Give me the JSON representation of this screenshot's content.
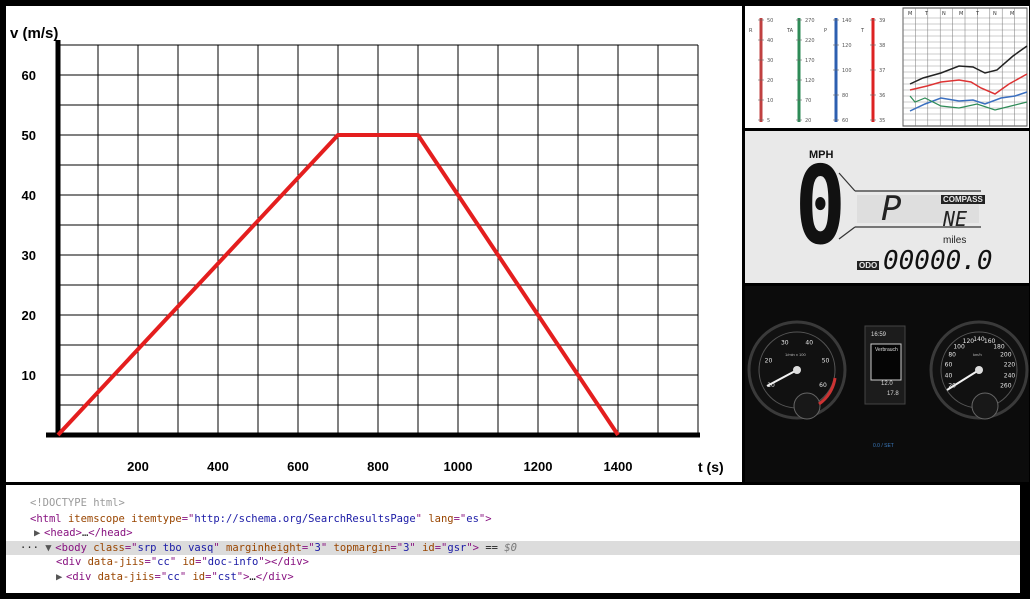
{
  "chart_data": {
    "type": "line",
    "xlabel": "t (s)",
    "ylabel": "v (m/s)",
    "x_ticks": [
      200,
      400,
      600,
      800,
      1000,
      1200,
      1400
    ],
    "y_ticks": [
      10,
      20,
      30,
      40,
      50,
      60
    ],
    "xlim": [
      0,
      1600
    ],
    "ylim": [
      0,
      65
    ],
    "grid": true,
    "x": [
      0,
      700,
      900,
      1400
    ],
    "series": [
      {
        "values": [
          0,
          50,
          50,
          0
        ],
        "color": "#e41e1e"
      }
    ]
  },
  "vitals_chart": {
    "scales": [
      {
        "label": "R",
        "ticks": [
          "50",
          "40",
          "30",
          "20",
          "10",
          "5"
        ],
        "color": "#c04040"
      },
      {
        "label": "TA",
        "ticks": [
          "270",
          "220",
          "170",
          "120",
          "70",
          "20"
        ],
        "color": "#2e8b57"
      },
      {
        "label": "P",
        "ticks": [
          "140",
          "120",
          "100",
          "80",
          "60"
        ],
        "color": "#2d5fb0"
      },
      {
        "label": "T",
        "ticks": [
          "39",
          "38",
          "37",
          "36",
          "35"
        ],
        "color": "#d22"
      }
    ],
    "day_header": [
      "M",
      "T",
      "N",
      "M",
      "T",
      "N",
      "M"
    ]
  },
  "lcd": {
    "unit": "MPH",
    "speed": "0",
    "gear": "P",
    "compass_label": "COMPASS",
    "compass_value": "NE",
    "miles_label": "miles",
    "odo_label": "ODO",
    "odometer": "00000.0"
  },
  "cluster": {
    "left_ticks": [
      "10",
      "20",
      "30",
      "40",
      "50",
      "60"
    ],
    "left_unit": "1/min x 100",
    "right_ticks": [
      "20",
      "40",
      "60",
      "80",
      "100",
      "120",
      "140",
      "160",
      "180",
      "200",
      "220",
      "240",
      "260"
    ],
    "right_unit": "km/h",
    "center_time": "16:59",
    "center_title": "Verbrauch",
    "center_value_1": "12.0",
    "center_value_2": "17.8",
    "bottom_text": "0.0 / SET"
  },
  "devtools": {
    "lines": [
      {
        "tokens": [
          {
            "t": "<!DOCTYPE html>",
            "c": "doctype"
          }
        ]
      },
      {
        "tokens": [
          {
            "t": "<html ",
            "c": "tag"
          },
          {
            "t": "itemscope itemtype",
            "c": "attr-name"
          },
          {
            "t": "=\"",
            "c": "tag"
          },
          {
            "t": "http://schema.org/SearchResultsPage",
            "c": "attr-val"
          },
          {
            "t": "\" ",
            "c": "tag"
          },
          {
            "t": "lang",
            "c": "attr-name"
          },
          {
            "t": "=\"",
            "c": "tag"
          },
          {
            "t": "es",
            "c": "attr-val"
          },
          {
            "t": "\">",
            "c": "tag"
          }
        ]
      },
      {
        "tokens": [
          {
            "t": "▶",
            "c": "tri"
          },
          {
            "t": "<head>",
            "c": "tag"
          },
          {
            "t": "…",
            "c": "plain"
          },
          {
            "t": "</head>",
            "c": "tag"
          }
        ]
      },
      {
        "tokens": [
          {
            "t": "··· ",
            "c": "plain"
          },
          {
            "t": "▼",
            "c": "tri"
          },
          {
            "t": "<body ",
            "c": "tag"
          },
          {
            "t": "class",
            "c": "attr-name"
          },
          {
            "t": "=\"",
            "c": "tag"
          },
          {
            "t": "srp tbo vasq",
            "c": "attr-val"
          },
          {
            "t": "\" ",
            "c": "tag"
          },
          {
            "t": "marginheight",
            "c": "attr-name"
          },
          {
            "t": "=\"",
            "c": "tag"
          },
          {
            "t": "3",
            "c": "attr-val"
          },
          {
            "t": "\" ",
            "c": "tag"
          },
          {
            "t": "topmargin",
            "c": "attr-name"
          },
          {
            "t": "=\"",
            "c": "tag"
          },
          {
            "t": "3",
            "c": "attr-val"
          },
          {
            "t": "\" ",
            "c": "tag"
          },
          {
            "t": "id",
            "c": "attr-name"
          },
          {
            "t": "=\"",
            "c": "tag"
          },
          {
            "t": "gsr",
            "c": "attr-val"
          },
          {
            "t": "\">",
            "c": "tag"
          },
          {
            "t": " == ",
            "c": "plain"
          },
          {
            "t": "$0",
            "c": "dollar"
          }
        ]
      },
      {
        "tokens": [
          {
            "t": "<div ",
            "c": "tag"
          },
          {
            "t": "data-jiis",
            "c": "attr-name"
          },
          {
            "t": "=\"",
            "c": "tag"
          },
          {
            "t": "cc",
            "c": "attr-val"
          },
          {
            "t": "\" ",
            "c": "tag"
          },
          {
            "t": "id",
            "c": "attr-name"
          },
          {
            "t": "=\"",
            "c": "tag"
          },
          {
            "t": "doc-info",
            "c": "attr-val"
          },
          {
            "t": "\"></div>",
            "c": "tag"
          }
        ]
      },
      {
        "tokens": [
          {
            "t": "▶",
            "c": "tri"
          },
          {
            "t": "<div ",
            "c": "tag"
          },
          {
            "t": "data-jiis",
            "c": "attr-name"
          },
          {
            "t": "=\"",
            "c": "tag"
          },
          {
            "t": "cc",
            "c": "attr-val"
          },
          {
            "t": "\" ",
            "c": "tag"
          },
          {
            "t": "id",
            "c": "attr-name"
          },
          {
            "t": "=\"",
            "c": "tag"
          },
          {
            "t": "cst",
            "c": "attr-val"
          },
          {
            "t": "\">",
            "c": "tag"
          },
          {
            "t": "…",
            "c": "plain"
          },
          {
            "t": "</div>",
            "c": "tag"
          }
        ]
      }
    ]
  }
}
